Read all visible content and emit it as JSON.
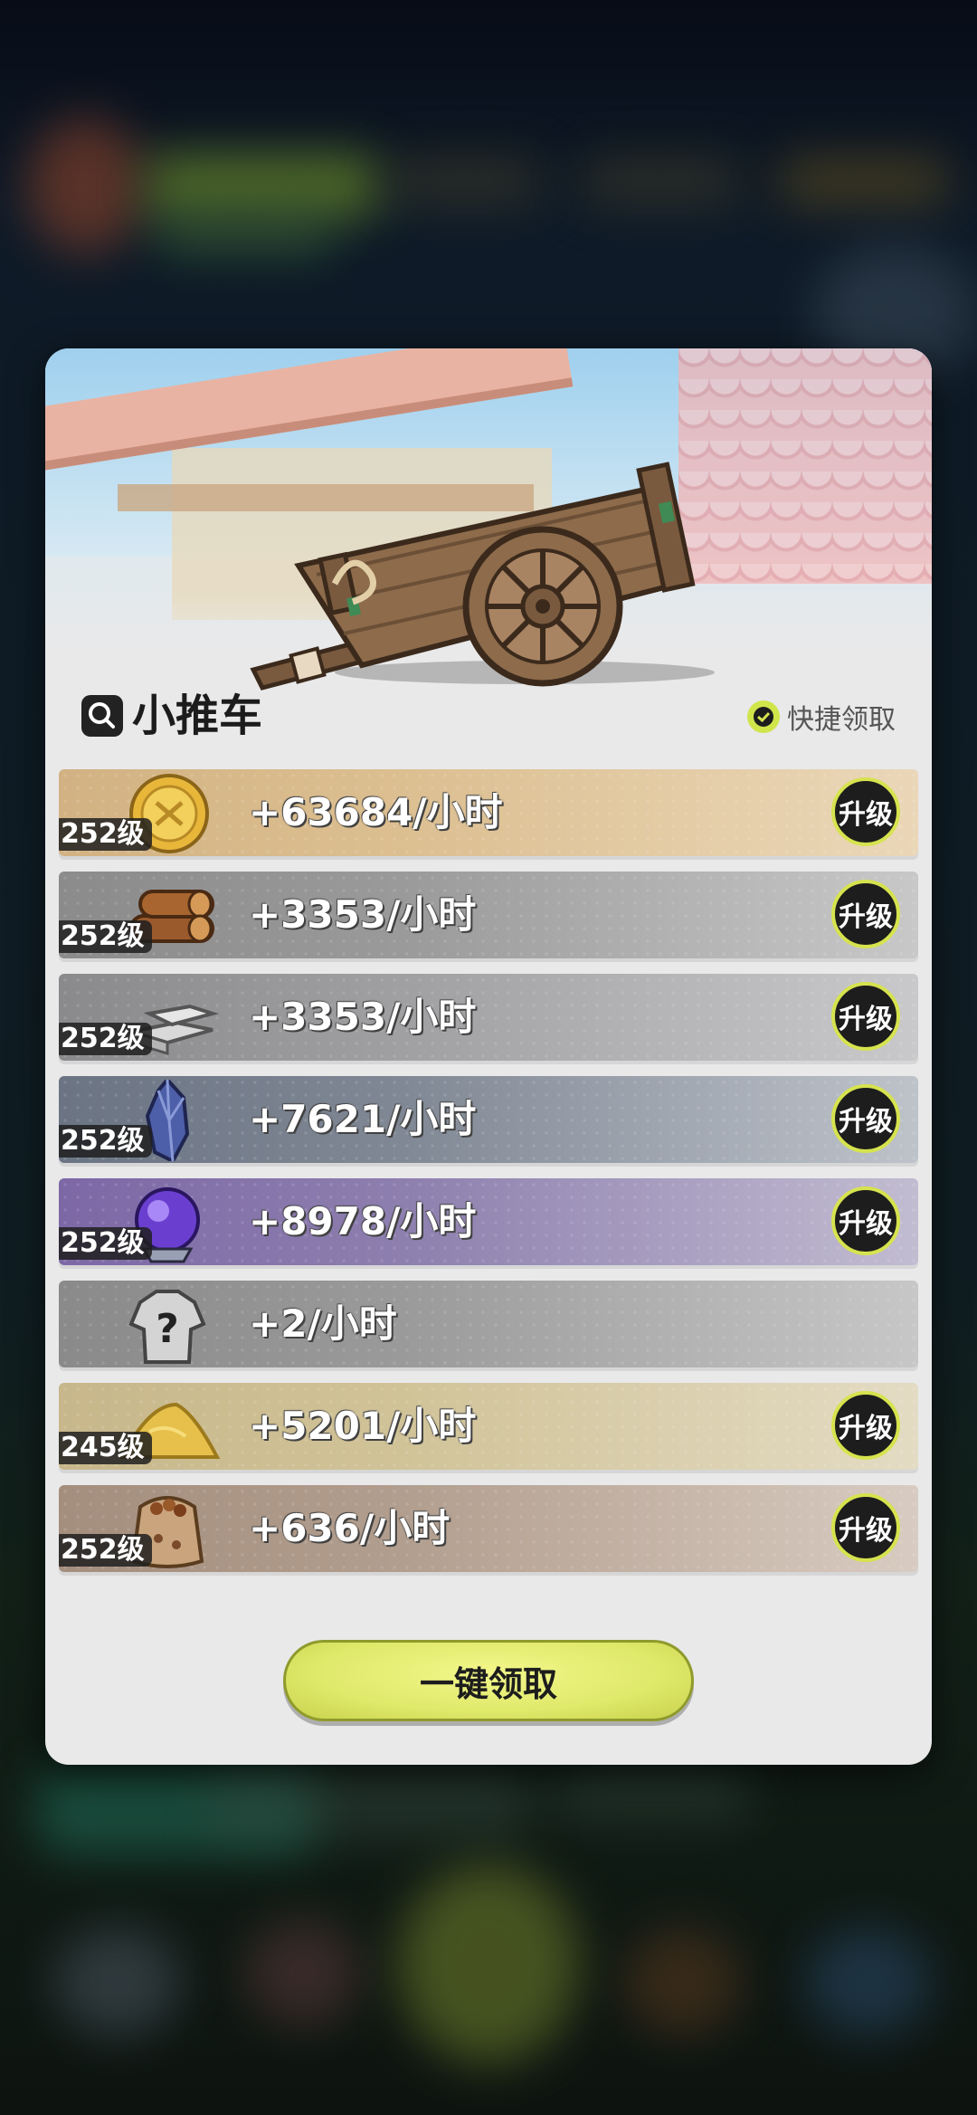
{
  "modal": {
    "title": "小推车",
    "quick_claim_label": "快捷领取",
    "claim_all_label": "一键领取"
  },
  "resources": [
    {
      "name": "gold-coin-icon",
      "level": "252级",
      "rate": "+63684/小时",
      "upgrade_label": "升级",
      "color": "#d2b283"
    },
    {
      "name": "wood-logs-icon",
      "level": "252级",
      "rate": "+3353/小时",
      "upgrade_label": "升级",
      "color": "#8b8b8b"
    },
    {
      "name": "iron-ingot-icon",
      "level": "252级",
      "rate": "+3353/小时",
      "upgrade_label": "升级",
      "color": "#8a8a8c"
    },
    {
      "name": "blue-crystal-icon",
      "level": "252级",
      "rate": "+7621/小时",
      "upgrade_label": "升级",
      "color": "#6b7483"
    },
    {
      "name": "purple-orb-icon",
      "level": "252级",
      "rate": "+8978/小时",
      "upgrade_label": "升级",
      "color": "#7d68a6"
    },
    {
      "name": "mystery-armor-icon",
      "level": "",
      "rate": "+2/小时",
      "upgrade_label": "",
      "color": "#8a8a8a"
    },
    {
      "name": "sand-pile-icon",
      "level": "245级",
      "rate": "+5201/小时",
      "upgrade_label": "升级",
      "color": "#c7b78b"
    },
    {
      "name": "seed-bag-icon",
      "level": "252级",
      "rate": "+636/小时",
      "upgrade_label": "升级",
      "color": "#a48e7e"
    }
  ],
  "colors": {
    "accent": "#d6e34e",
    "button": "#e3ec6e",
    "panel": "#e9e9ea"
  }
}
